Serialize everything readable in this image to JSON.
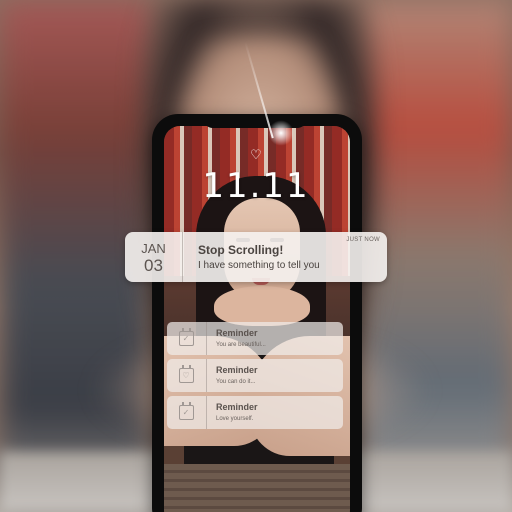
{
  "lock_screen": {
    "time": "11.11",
    "lock_icon": "heart-icon"
  },
  "notification": {
    "date_month": "JAN",
    "date_day": "03",
    "title": "Stop Scrolling!",
    "body": "I have something to tell you",
    "timestamp": "JUST NOW"
  },
  "reminders": [
    {
      "title": "Reminder",
      "body": "You are beautiful...",
      "icon": "calendar-check-icon"
    },
    {
      "title": "Reminder",
      "body": "You can do it...",
      "icon": "calendar-heart-icon"
    },
    {
      "title": "Reminder",
      "body": "Love yourself.",
      "icon": "calendar-check-icon"
    }
  ]
}
